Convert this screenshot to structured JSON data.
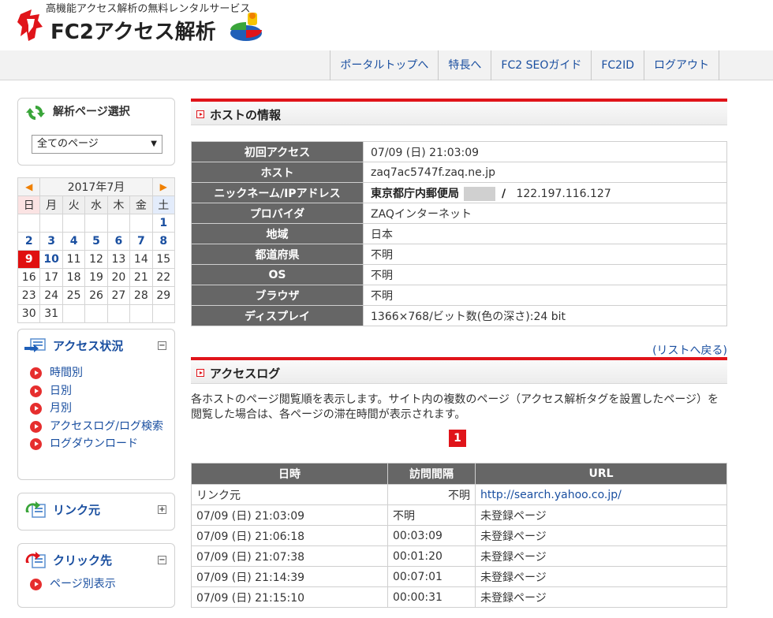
{
  "header": {
    "tagline": "高機能アクセス解析の無料レンタルサービス",
    "logo": "FC2アクセス解析",
    "nav": [
      "ポータルトップへ",
      "特長へ",
      "FC2 SEOガイド",
      "FC2ID",
      "ログアウト"
    ]
  },
  "sidebar": {
    "select_box": {
      "title": "解析ページ選択",
      "selected": "全てのページ"
    },
    "calendar": {
      "month_label": "2017年7月",
      "dow": [
        "日",
        "月",
        "火",
        "水",
        "木",
        "金",
        "土"
      ],
      "weeks": [
        [
          "",
          "",
          "",
          "",
          "",
          "",
          "1"
        ],
        [
          "2",
          "3",
          "4",
          "5",
          "6",
          "7",
          "8"
        ],
        [
          "9",
          "10",
          "11",
          "12",
          "13",
          "14",
          "15"
        ],
        [
          "16",
          "17",
          "18",
          "19",
          "20",
          "21",
          "22"
        ],
        [
          "23",
          "24",
          "25",
          "26",
          "27",
          "28",
          "29"
        ],
        [
          "30",
          "31",
          "",
          "",
          "",
          "",
          ""
        ]
      ],
      "linked_days": [
        "1",
        "2",
        "3",
        "4",
        "5",
        "6",
        "7",
        "8",
        "10"
      ],
      "today": "9"
    },
    "access_menu": {
      "title": "アクセス状況",
      "items": [
        "時間別",
        "日別",
        "月別",
        "アクセスログ/ログ検索",
        "ログダウンロード"
      ]
    },
    "link_menu": {
      "title": "リンク元"
    },
    "click_menu": {
      "title": "クリック先",
      "items": [
        "ページ別表示"
      ]
    }
  },
  "host_info": {
    "title": "ホストの情報",
    "rows": [
      {
        "key": "初回アクセス",
        "value": "07/09 (日) 21:03:09"
      },
      {
        "key": "ホスト",
        "value": "zaq7ac5747f.zaq.ne.jp"
      },
      {
        "key": "ニックネーム/IPアドレス",
        "nickname": "東京都庁内郵便局",
        "separator": "/",
        "ip": "122.197.116.127"
      },
      {
        "key": "プロバイダ",
        "value": "ZAQインターネット"
      },
      {
        "key": "地域",
        "value": "日本"
      },
      {
        "key": "都道府県",
        "value": "不明"
      },
      {
        "key": "OS",
        "value": "不明"
      },
      {
        "key": "ブラウザ",
        "value": "不明"
      },
      {
        "key": "ディスプレイ",
        "value": "1366×768/ビット数(色の深さ):24 bit"
      }
    ],
    "back_link": "(リストへ戻る)"
  },
  "access_log": {
    "title": "アクセスログ",
    "description": "各ホストのページ閲覧順を表示します。サイト内の複数のページ（アクセス解析タグを設置したページ）を閲覧した場合は、各ページの滞在時間が表示されます。",
    "page": "1",
    "headers": [
      "日時",
      "訪問間隔",
      "URL"
    ],
    "rows": [
      [
        "リンク元",
        "不明",
        "http://search.yahoo.co.jp/"
      ],
      [
        "07/09 (日) 21:03:09",
        "不明",
        "未登録ページ"
      ],
      [
        "07/09 (日) 21:06:18",
        "00:03:09",
        "未登録ページ"
      ],
      [
        "07/09 (日) 21:07:38",
        "00:01:20",
        "未登録ページ"
      ],
      [
        "07/09 (日) 21:14:39",
        "00:07:01",
        "未登録ページ"
      ],
      [
        "07/09 (日) 21:15:10",
        "00:00:31",
        "未登録ページ"
      ]
    ]
  }
}
